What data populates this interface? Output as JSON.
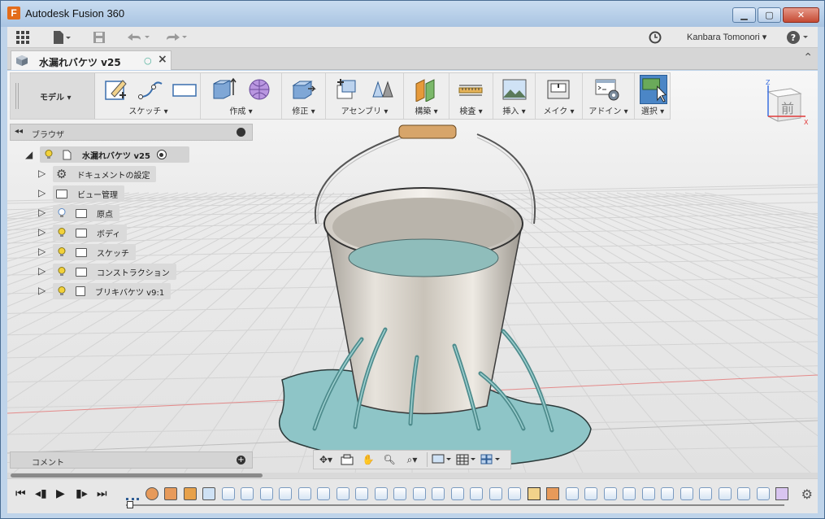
{
  "window": {
    "title": "Autodesk Fusion 360",
    "logo_letter": "F",
    "controls": [
      "minimize",
      "maximize",
      "close"
    ]
  },
  "app_toolbar": {
    "user_name": "Kanbara Tomonori",
    "icons": [
      "grid-icon",
      "file-icon",
      "save-icon",
      "undo-icon",
      "redo-icon",
      "clock-icon",
      "help-icon"
    ]
  },
  "doc_tab": {
    "name": "水漏れバケツ v25"
  },
  "ribbon": {
    "workspace": "モデル",
    "groups": [
      {
        "label": "スケッチ",
        "dropdown": true
      },
      {
        "label": "作成",
        "dropdown": true
      },
      {
        "label": "修正",
        "dropdown": true
      },
      {
        "label": "アセンブリ",
        "dropdown": true
      },
      {
        "label": "構築",
        "dropdown": true
      },
      {
        "label": "検査",
        "dropdown": true
      },
      {
        "label": "挿入",
        "dropdown": true
      },
      {
        "label": "メイク",
        "dropdown": true
      },
      {
        "label": "アドイン",
        "dropdown": true
      },
      {
        "label": "選択",
        "dropdown": true
      }
    ]
  },
  "viewcube": {
    "face_label": "前",
    "axes": [
      "Z",
      "X"
    ]
  },
  "browser": {
    "title": "ブラウザ",
    "root": "水漏れバケツ v25",
    "items": [
      {
        "label": "ドキュメントの設定",
        "icon": "gear-icon",
        "bulb": false
      },
      {
        "label": "ビュー管理",
        "icon": "folder-icon",
        "bulb": false
      },
      {
        "label": "原点",
        "icon": "folder-icon",
        "bulb": true,
        "bulb_on": false
      },
      {
        "label": "ボディ",
        "icon": "folder-icon",
        "bulb": true,
        "bulb_on": true
      },
      {
        "label": "スケッチ",
        "icon": "folder-icon",
        "bulb": true,
        "bulb_on": true
      },
      {
        "label": "コンストラクション",
        "icon": "folder-icon",
        "bulb": true,
        "bulb_on": true
      },
      {
        "label": "ブリキバケツ v9:1",
        "icon": "component-icon",
        "bulb": true,
        "bulb_on": true
      }
    ]
  },
  "comments": {
    "title": "コメント"
  },
  "navbar": {
    "tools": [
      "orbit-icon",
      "look-at-icon",
      "pan-icon",
      "zoom-icon",
      "zoom-window-icon",
      "display-settings-icon",
      "grid-settings-icon",
      "viewports-icon"
    ]
  },
  "timeline": {
    "controls": [
      "go-to-start",
      "previous-step",
      "play",
      "next-step",
      "go-to-end"
    ],
    "item_count": 35
  },
  "colors": {
    "accent": "#4b86c6",
    "water": "#8ec5c7",
    "bucket": "#cfcac2",
    "bulb_on": "#f2d13a"
  }
}
